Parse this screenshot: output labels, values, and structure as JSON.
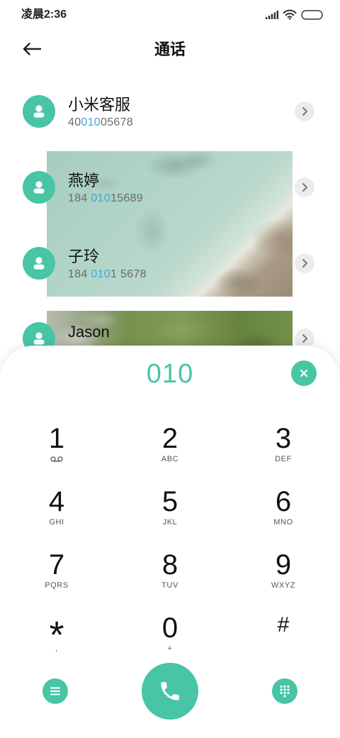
{
  "status_bar": {
    "time": "凌晨2:36",
    "icons": [
      "signal-icon",
      "wifi-icon",
      "battery-icon"
    ]
  },
  "header": {
    "back_icon": "arrow-left-icon",
    "title": "通话"
  },
  "contacts": [
    {
      "name": "小米客服",
      "number": {
        "before": "40",
        "match": "010",
        "after": "05678"
      },
      "avatar_icon": "person-icon",
      "action_icon": "chevron-right-icon"
    },
    {
      "name": "燕婷",
      "number": {
        "before": "184 ",
        "match": "010",
        "after": "15689"
      },
      "avatar_icon": "person-icon",
      "action_icon": "chevron-right-icon"
    },
    {
      "name": "子玲",
      "number": {
        "before": "184 ",
        "match": "010",
        "after": "1 5678"
      },
      "avatar_icon": "person-icon",
      "action_icon": "chevron-right-icon"
    },
    {
      "name": "Jason",
      "avatar_icon": "person-icon",
      "action_icon": "chevron-right-icon"
    }
  ],
  "dialer": {
    "input": "010",
    "clear_icon": "close-icon",
    "keys": [
      {
        "digit": "1",
        "sub_icon": "voicemail-icon"
      },
      {
        "digit": "2",
        "sub": "ABC"
      },
      {
        "digit": "3",
        "sub": "DEF"
      },
      {
        "digit": "4",
        "sub": "GHI"
      },
      {
        "digit": "5",
        "sub": "JKL"
      },
      {
        "digit": "6",
        "sub": "MNO"
      },
      {
        "digit": "7",
        "sub": "PQRS"
      },
      {
        "digit": "8",
        "sub": "TUV"
      },
      {
        "digit": "9",
        "sub": "WXYZ"
      },
      {
        "digit": "*",
        "sub": ","
      },
      {
        "digit": "0",
        "sub": "+"
      },
      {
        "digit": "#"
      }
    ],
    "actions": {
      "menu_icon": "menu-icon",
      "call_icon": "phone-icon",
      "keypad_icon": "dialpad-icon"
    }
  },
  "colors": {
    "accent": "#47c5a5",
    "match_highlight": "#3ea8dc",
    "text_primary": "#111111",
    "text_secondary": "#6b6b6b",
    "chevron_bg": "#ececec"
  }
}
